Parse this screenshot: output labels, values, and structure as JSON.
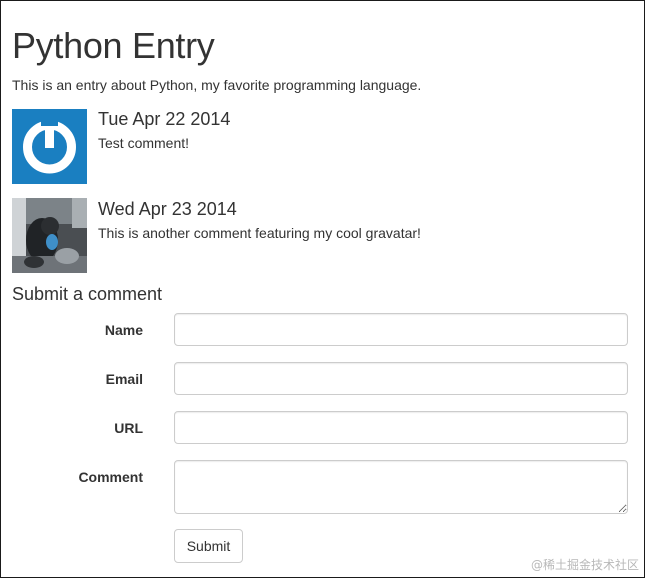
{
  "page": {
    "title": "Python Entry",
    "intro": "This is an entry about Python, my favorite programming language."
  },
  "comments": [
    {
      "date": "Tue Apr 22 2014",
      "text": "Test comment!",
      "avatar_icon": "power-logo-avatar",
      "avatar_color": "#1a7fc1"
    },
    {
      "date": "Wed Apr 23 2014",
      "text": "This is another comment featuring my cool gravatar!",
      "avatar_icon": "photo-avatar"
    }
  ],
  "form": {
    "title": "Submit a comment",
    "fields": [
      {
        "label": "Name",
        "value": ""
      },
      {
        "label": "Email",
        "value": ""
      },
      {
        "label": "URL",
        "value": ""
      },
      {
        "label": "Comment",
        "value": ""
      }
    ],
    "submit_label": "Submit"
  },
  "watermark": "@稀土掘金技术社区"
}
